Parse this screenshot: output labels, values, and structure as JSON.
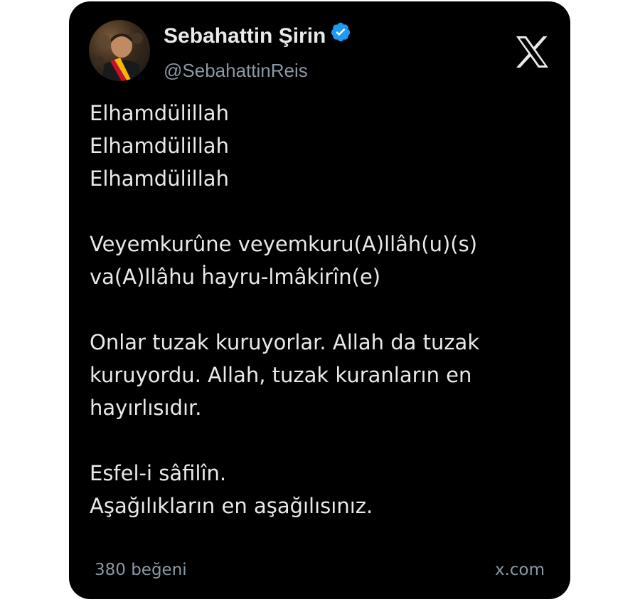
{
  "post": {
    "author_name": "Sebahattin Şirin",
    "author_handle": "@SebahattinReis",
    "verified_icon": "verified-badge-icon",
    "platform_icon": "x-logo-icon",
    "accent_color": "#1d9bf0",
    "background_color": "#000000",
    "text_color": "#e7e9ea",
    "muted_color": "#8b98a5",
    "paragraphs": [
      [
        "Elhamdülillah",
        "Elhamdülillah",
        "Elhamdülillah"
      ],
      [
        "Veyemkurûne veyemkuru(A)llâh(u)(s)",
        "va(A)llâhu ḣayru-lmâkirîn(e)"
      ],
      [
        "Onlar tuzak kuruyorlar. Allah da tuzak",
        "kuruyordu. Allah, tuzak kuranların en",
        "hayırlısıdır."
      ],
      [
        "Esfel-i sâfilîn.",
        "Aşağılıkların en aşağılısınız."
      ]
    ],
    "likes": "380 beğeni",
    "source": "x.com"
  }
}
